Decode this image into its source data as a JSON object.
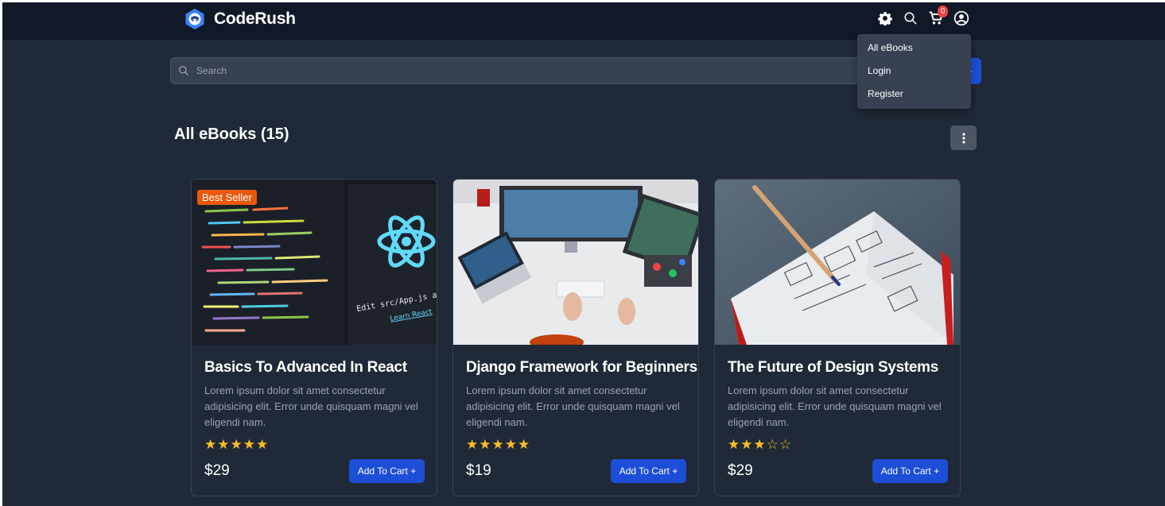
{
  "app": {
    "name": "CodeRush"
  },
  "header": {
    "cart_count": "0"
  },
  "menu": {
    "items": [
      "All eBooks",
      "Login",
      "Register"
    ]
  },
  "search": {
    "placeholder": "Search"
  },
  "section": {
    "title": "All eBooks (15)"
  },
  "products": [
    {
      "badge": "Best Seller",
      "title": "Basics To Advanced In React",
      "description": "Lorem ipsum dolor sit amet consectetur adipisicing elit. Error unde quisquam magni vel eligendi nam.",
      "stars": "★★★★★",
      "rating": 5,
      "price": "$29",
      "button": "Add To Cart",
      "image_text": [
        "Edit src/App.js and save to reload.",
        "Learn React"
      ]
    },
    {
      "badge": "",
      "title": "Django Framework for Beginners",
      "description": "Lorem ipsum dolor sit amet consectetur adipisicing elit. Error unde quisquam magni vel eligendi nam.",
      "stars": "★★★★★",
      "rating": 5,
      "price": "$19",
      "button": "Add To Cart"
    },
    {
      "badge": "",
      "title": "The Future of Design Systems",
      "description": "Lorem ipsum dolor sit amet consectetur adipisicing elit. Error unde quisquam magni vel eligendi nam.",
      "stars": "★★★☆☆",
      "rating": 3,
      "price": "$29",
      "button": "Add To Cart"
    }
  ],
  "colors": {
    "navbar": "#111827",
    "background": "#1f2937",
    "accent": "#1d4ed8",
    "badge": "#ea580c",
    "star": "#fbbf24",
    "cart_badge": "#ef4444"
  },
  "icons": [
    "logo-icon",
    "gear-icon",
    "search-icon",
    "cart-icon",
    "user-circle-icon",
    "kebab-menu-icon",
    "plus-icon"
  ]
}
